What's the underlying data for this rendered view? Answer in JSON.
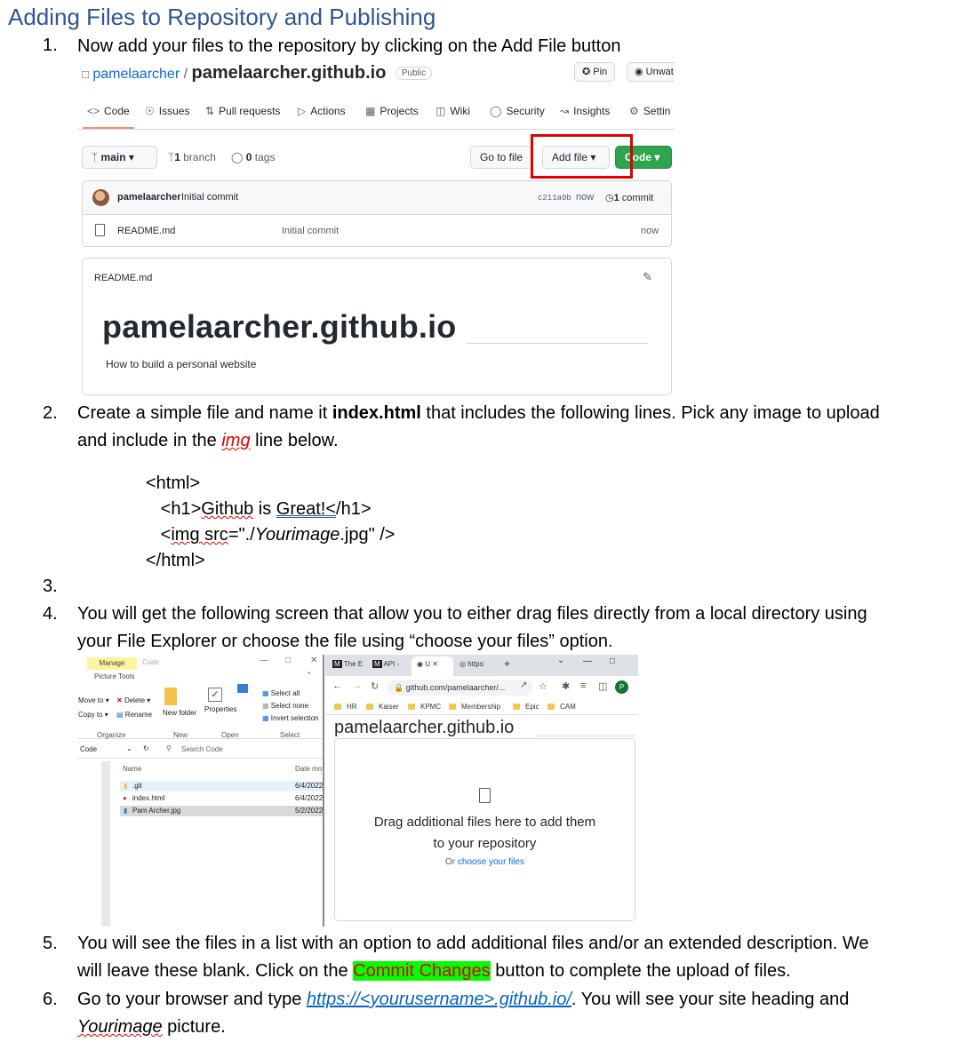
{
  "heading": "Adding Files to Repository and Publishing",
  "steps": {
    "s1": {
      "num": "1.",
      "text": "Now add your files to the repository by clicking on the Add File button"
    },
    "s2": {
      "num": "2.",
      "pre": "Create a simple file and name it ",
      "bold": "index.html",
      "mid": " that includes the following lines.   Pick any image to upload",
      "line2_pre": "and include in the ",
      "img_word": "img",
      "line2_post": " line below."
    },
    "s3": {
      "num": "3."
    },
    "s4": {
      "num": "4.",
      "line1": "You will get the following screen that allow you to either drag files directly from a local directory using",
      "line2": "your File Explorer or choose the file using “choose your files” option."
    },
    "s5": {
      "num": "5.",
      "line1": "You will see the files in a list with an option to add additional files and/or an extended description.  We",
      "line2_pre": "will leave these blank.  Click on the ",
      "highlight": "Commit Changes",
      "line2_post": " button to complete the upload of files."
    },
    "s6": {
      "num": "6.",
      "line1_pre": "Go to your browser and type ",
      "link": "https://<yourusername>.github.io/",
      "line1_post": ".  You will see your site heading and",
      "line2_word": "Yourimage",
      "line2_post": " picture."
    }
  },
  "code": {
    "l1": "<html>",
    "l2_pre": "   <h1>",
    "l2_w1": "Github",
    "l2_mid": " is ",
    "l2_w2": "Great!<",
    "l2_post": "/h1>",
    "l3_pre": "   <",
    "l3_w1": "img src",
    "l3_mid": "=\"./",
    "l3_italic": "Yourimage",
    "l3_post": ".jpg\" />",
    "l4": "</html>"
  },
  "github": {
    "owner": "pamelaarcher",
    "slash": " / ",
    "repo": "pamelaarcher.github.io",
    "visibility": "Public",
    "pin": "Pin",
    "unwatch": "Unwat",
    "tabs": [
      "Code",
      "Issues",
      "Pull requests",
      "Actions",
      "Projects",
      "Wiki",
      "Security",
      "Insights",
      "Settin"
    ],
    "branch_btn": "main",
    "branch_count": "1",
    "branch_label": " branch",
    "tag_count": "0",
    "tag_label": " tags",
    "go_to_file": "Go to file",
    "add_file": "Add file",
    "code_btn": "Code",
    "commit": {
      "author": "pamelaarcher",
      "message": "Initial commit",
      "sha": "c211a0b",
      "time": "now",
      "count": "1",
      "count_label": " commit"
    },
    "files": [
      {
        "name": "README.md",
        "message": "Initial commit",
        "time": "now"
      }
    ],
    "readme": {
      "filename": "README.md",
      "h1": "pamelaarcher.github.io",
      "desc": "How to build a personal website"
    }
  },
  "explorer": {
    "manage": "Manage",
    "title": "Code",
    "picture_tools": "Picture Tools",
    "ribbon": {
      "move_to": "Move to",
      "delete": "Delete",
      "copy_to": "Copy to",
      "rename": "Rename",
      "new_folder": "New folder",
      "properties": "Properties",
      "select_all": "Select all",
      "select_none": "Select none",
      "invert_selection": "Invert selection",
      "groups": [
        "Organize",
        "New",
        "Open",
        "Select"
      ]
    },
    "address": "Code",
    "search_placeholder": "Search Code",
    "col_name": "Name",
    "col_date": "Date mo",
    "rows": [
      {
        "name": ".git",
        "date": "6/4/2022"
      },
      {
        "name": "index.html",
        "date": "6/4/2022"
      },
      {
        "name": "Pam Archer.jpg",
        "date": "5/2/2022"
      }
    ]
  },
  "chrome": {
    "tabs": [
      "The E",
      "API - ",
      "U",
      "https:"
    ],
    "url": "github.com/pamelaarcher/...",
    "profile": "P",
    "bookmarks": [
      "HR",
      "Kaiser",
      "KPMC",
      "Membership",
      "Epic",
      "CAM"
    ],
    "page_title": "pamelaarcher.github.io",
    "drop_line1": "Drag additional files here to add them",
    "drop_line2": "to your repository",
    "choose_pre": "Or ",
    "choose_link": "choose your files"
  },
  "colors": {
    "heading": "#2f5496",
    "github_link": "#0969da",
    "code_button": "#2da44e",
    "highlight_box": "#e00000",
    "commit_highlight_bg": "#00ff00",
    "commit_highlight_text": "#e00000"
  }
}
